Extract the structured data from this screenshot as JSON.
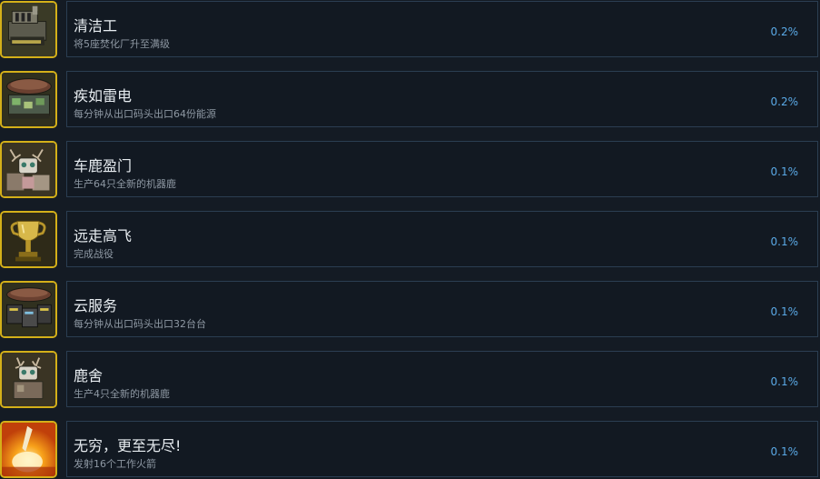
{
  "achievements": [
    {
      "title": "清洁工",
      "desc": "将5座焚化厂升至满级",
      "percent": "0.2%",
      "icon": "incinerator-icon"
    },
    {
      "title": "疾如雷电",
      "desc": "每分钟从出口码头出口64份能源",
      "percent": "0.2%",
      "icon": "export-dock-energy-icon"
    },
    {
      "title": "车鹿盈门",
      "desc": "生产64只全新的机器鹿",
      "percent": "0.1%",
      "icon": "robot-deer-herd-icon"
    },
    {
      "title": "远走高飞",
      "desc": "完成战役",
      "percent": "0.1%",
      "icon": "trophy-icon"
    },
    {
      "title": "云服务",
      "desc": "每分钟从出口码头出口32台台",
      "percent": "0.1%",
      "icon": "export-dock-server-icon"
    },
    {
      "title": "鹿舍",
      "desc": "生产4只全新的机器鹿",
      "percent": "0.1%",
      "icon": "robot-deer-icon"
    },
    {
      "title": "无穷，更至无尽!",
      "desc": "发射16个工作火箭",
      "percent": "0.1%",
      "icon": "rocket-launch-icon"
    }
  ]
}
